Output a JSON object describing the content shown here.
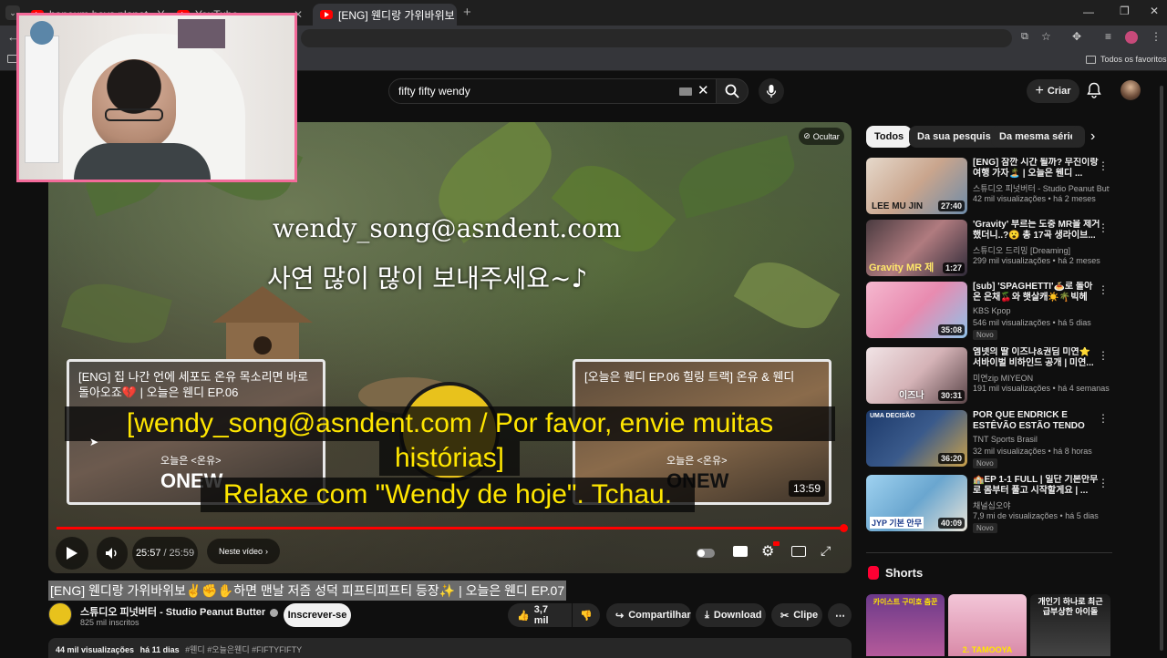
{
  "browser": {
    "tabs": [
      {
        "title": "haneum boys planet - YouTube"
      },
      {
        "title": "YouTube"
      },
      {
        "title": "[ENG] 웬디랑 가위바위보✌️✊✋"
      }
    ],
    "bookmarks_label": "Todos os favoritos"
  },
  "header": {
    "search_value": "fifty fifty wendy",
    "create_label": "Criar"
  },
  "video": {
    "overlay_hide_label": "Ocultar",
    "handwriting_line1": "wendy_song@asndent.com",
    "handwriting_line2": "사연 많이 많이 보내주세요~♪",
    "endcard_left_title": "[ENG] 집 나간 언에 세포도 온유 목소리면 바로 돌아오죠💔 | 오늘은 웬디 EP.06",
    "endcard_left_sub": "오늘은 <온유>",
    "endcard_left_brand": "ONEW",
    "endcard_right_title": "[오늘은 웬디 EP.06 힐링 트랙] 온유 & 웬디",
    "endcard_right_sub": "오늘은 <온유>",
    "endcard_right_brand": "ONEW",
    "endcard_right_duration": "13:59",
    "caption_line1": "[wendy_song@asndent.com / Por favor, envie muitas",
    "caption_line2": "histórias]",
    "caption_line3": "Relaxe com \"Wendy de hoje\". Tchau.",
    "time_current": "25:57",
    "time_separator": "/",
    "time_total": "25:59",
    "chapter_label": "Neste vídeo",
    "progress_fraction": 0.9987,
    "title": "[ENG] 웬디랑 가위바위보✌️✊✋하면 맨날 저즘 성덕 피프티피프티 등장✨ | 오늘은 웬디 EP.07"
  },
  "channel": {
    "name": "스튜디오 피넛버터 - Studio Peanut Butter",
    "subscribers": "825 mil inscritos",
    "subscribe_label": "Inscrever-se"
  },
  "actions": {
    "likes": "3,7 mil",
    "share": "Compartilhar",
    "download": "Download",
    "clip": "Clipe"
  },
  "description": {
    "views": "44 mil visualizações",
    "age": "há 11 dias",
    "tags": "#웬디 #오늘은웬디 #FIFTYFIFTY"
  },
  "sidebar": {
    "chips": [
      "Todos",
      "Da sua pesquisa",
      "Da mesma série"
    ],
    "recommendations": [
      {
        "title": "[ENG] 잠깐 시간 될까? 무진이랑 여행 가자🏝️ | 오늘은 웬디 ...",
        "channel": "스튜디오 피넛버터 - Studio Peanut Butte...",
        "meta": "42 mil visualizações • há 2 meses",
        "duration": "27:40",
        "thumb_text": "LEE MU JIN",
        "badge": ""
      },
      {
        "title": "'Gravity' 부르는 도중 MR을 제거했더니..?😮 총 17곡 생라이브...",
        "channel": "스튜디오 드리밍 [Dreaming]",
        "meta": "299 mil visualizações • há 2 meses",
        "duration": "1:27",
        "thumb_text": "Gravity MR 제",
        "badge": ""
      },
      {
        "title": "[sub] 'SPAGHETTI'🍝로 돌아온 은채🍒와 햇살캐☀️🌴빅헤즈...",
        "channel": "KBS Kpop",
        "meta": "546 mil visualizações • há 5 dias",
        "duration": "35:08",
        "thumb_text": "",
        "badge": "Novo"
      },
      {
        "title": "엠넷의 딸 이즈나&권딤 미연⭐ 서바이벌 비하인드 공개 | 미연...",
        "channel": "미연zip MIYEON",
        "meta": "191 mil visualizações • há 4 semanas",
        "duration": "30:31",
        "thumb_text": "이즈나",
        "badge": ""
      },
      {
        "title": "POR QUE ENDRICK E ESTÊVÃO ESTÃO TENDO REALIDADES ...",
        "channel": "TNT Sports Brasil",
        "meta": "32 mil visualizações • há 8 horas",
        "duration": "36:20",
        "thumb_text": "UMA DECISÃO",
        "badge": "Novo"
      },
      {
        "title": "🏫EP 1-1 FULL | 일단 기본안무로 몸부터 풀고 시작할게요 | ...",
        "channel": "채널십오야",
        "meta": "7,9 mi de visualizações • há 5 dias",
        "duration": "40:09",
        "thumb_text": "JYP 기본 안무",
        "badge": "Novo"
      }
    ],
    "shorts_title": "Shorts",
    "shorts": [
      {
        "text": "카이스트 구미호 춤꾼"
      },
      {
        "text": "2. TAMOOYA"
      },
      {
        "text": "개인기 하나로 최근 급부상한 아이돌"
      }
    ]
  }
}
